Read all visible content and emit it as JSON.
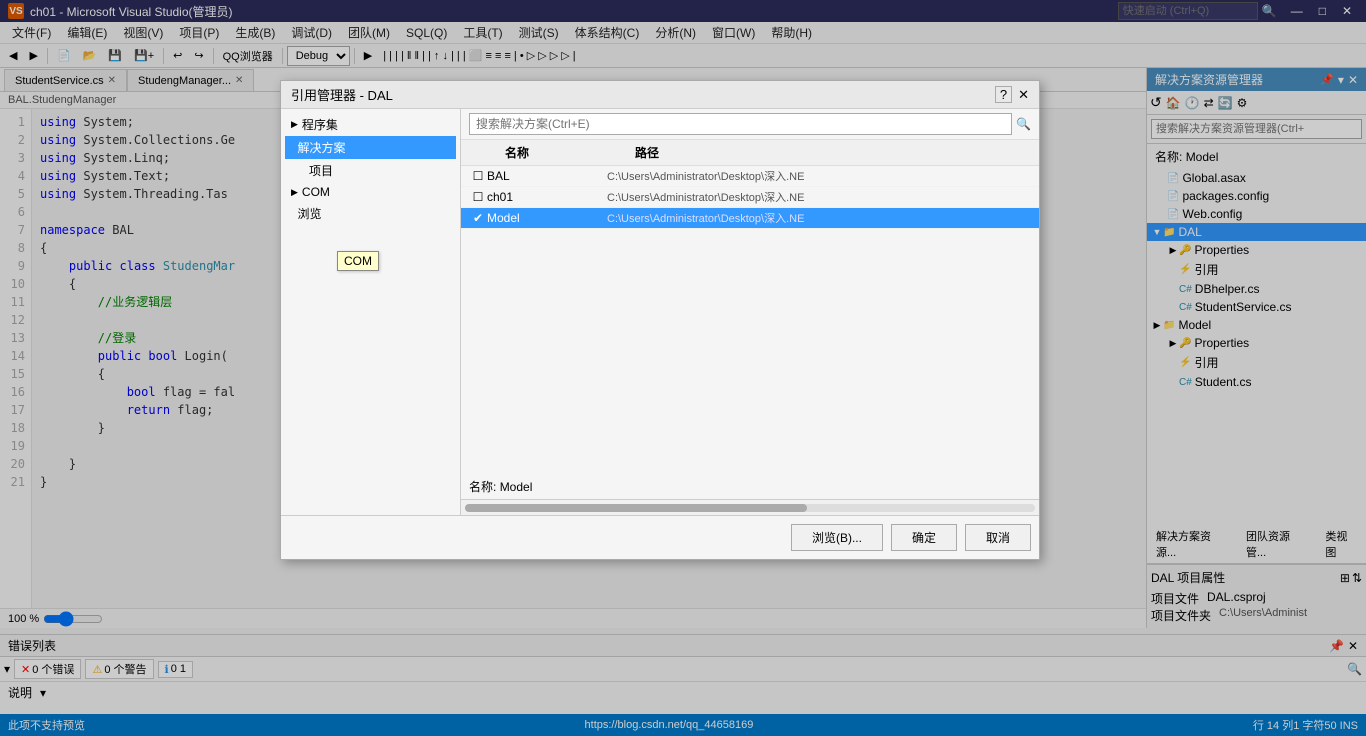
{
  "titleBar": {
    "icon": "VS",
    "title": "ch01 - Microsoft Visual Studio(管理员)",
    "searchPlaceholder": "快速启动 (Ctrl+Q)",
    "controls": [
      "—",
      "□",
      "✕"
    ]
  },
  "menuBar": {
    "items": [
      "文件(F)",
      "编辑(E)",
      "视图(V)",
      "项目(P)",
      "生成(B)",
      "调试(D)",
      "团队(M)",
      "SQL(Q)",
      "工具(T)",
      "测试(S)",
      "体系结构(C)",
      "分析(N)",
      "窗口(W)",
      "帮助(H)"
    ]
  },
  "toolbar": {
    "debugMode": "Debug",
    "browser": "QQ浏览器"
  },
  "tabs": {
    "items": [
      "StudentService.cs",
      "StudengManager...",
      "BAL.StudengManager"
    ]
  },
  "codeEditor": {
    "breadcrumb": "BAL.StudengManager",
    "lines": [
      {
        "num": 1,
        "text": "using System;",
        "indent": 0
      },
      {
        "num": 2,
        "text": "using System.Collections.Ge",
        "indent": 0
      },
      {
        "num": 3,
        "text": "using System.Linq;",
        "indent": 0
      },
      {
        "num": 4,
        "text": "using System.Text;",
        "indent": 0
      },
      {
        "num": 5,
        "text": "using System.Threading.Tas",
        "indent": 0
      },
      {
        "num": 6,
        "text": "",
        "indent": 0
      },
      {
        "num": 7,
        "text": "namespace BAL",
        "indent": 0
      },
      {
        "num": 8,
        "text": "{",
        "indent": 0
      },
      {
        "num": 9,
        "text": "public class StudengMar",
        "indent": 1
      },
      {
        "num": 10,
        "text": "{",
        "indent": 2
      },
      {
        "num": 11,
        "text": "//业务逻辑层",
        "indent": 3
      },
      {
        "num": 12,
        "text": "",
        "indent": 0
      },
      {
        "num": 13,
        "text": "//登录",
        "indent": 3
      },
      {
        "num": 14,
        "text": "public bool Login(",
        "indent": 3
      },
      {
        "num": 15,
        "text": "{",
        "indent": 4
      },
      {
        "num": 16,
        "text": "bool flag = fal",
        "indent": 5
      },
      {
        "num": 17,
        "text": "return flag;",
        "indent": 5
      },
      {
        "num": 18,
        "text": "}",
        "indent": 4
      },
      {
        "num": 19,
        "text": "",
        "indent": 0
      },
      {
        "num": 20,
        "text": "}",
        "indent": 2
      },
      {
        "num": 21,
        "text": "}",
        "indent": 0
      }
    ],
    "zoom": "100 %"
  },
  "rightPanel": {
    "title": "解决方案资源管理器",
    "searchPlaceholder": "搜索解决方案资源管理器(Ctrl+",
    "nameLabel": "名称:",
    "nameValue": "Model",
    "treeItems": [
      {
        "label": "Global.asax",
        "level": 1,
        "icon": "file",
        "hasArrow": false
      },
      {
        "label": "packages.config",
        "level": 1,
        "icon": "file",
        "hasArrow": false
      },
      {
        "label": "Web.config",
        "level": 1,
        "icon": "file",
        "hasArrow": false
      },
      {
        "label": "DAL",
        "level": 0,
        "icon": "folder",
        "hasArrow": true,
        "selected": true
      },
      {
        "label": "Properties",
        "level": 1,
        "icon": "folder",
        "hasArrow": true
      },
      {
        "label": "引用",
        "level": 1,
        "icon": "ref",
        "hasArrow": false
      },
      {
        "label": "DBhelper.cs",
        "level": 1,
        "icon": "cs",
        "hasArrow": false
      },
      {
        "label": "StudentService.cs",
        "level": 1,
        "icon": "cs",
        "hasArrow": false
      },
      {
        "label": "Model",
        "level": 0,
        "icon": "folder",
        "hasArrow": true
      },
      {
        "label": "Properties",
        "level": 1,
        "icon": "folder",
        "hasArrow": true
      },
      {
        "label": "引用",
        "level": 1,
        "icon": "ref",
        "hasArrow": false
      },
      {
        "label": "Student.cs",
        "level": 1,
        "icon": "cs",
        "hasArrow": false
      }
    ],
    "subTabs": [
      "解决方案资源...",
      "团队资源管...",
      "类视图"
    ]
  },
  "bottomPanel": {
    "title": "错误列表",
    "errorCount": "0 个错误",
    "warningCount": "0 个警告",
    "messageCount": "0 1",
    "filterLabel": "说明"
  },
  "statusBar": {
    "leftText": "此项不支持预览",
    "rightText": "行 14    列1    字符50    INS",
    "url": "https://blog.csdn.net/qq_44658169"
  },
  "modal": {
    "title": "引用管理器 - DAL",
    "closeBtn": "✕",
    "questionBtn": "?",
    "leftItems": [
      {
        "label": "程序集",
        "hasArrow": true,
        "level": 0
      },
      {
        "label": "解决方案",
        "hasArrow": false,
        "level": 0,
        "selected": true
      },
      {
        "label": "项目",
        "hasArrow": false,
        "level": 1
      },
      {
        "label": "COM",
        "hasArrow": true,
        "level": 0
      },
      {
        "label": "浏览",
        "hasArrow": false,
        "level": 0
      }
    ],
    "searchPlaceholder": "搜索解决方案(Ctrl+E)",
    "nameLabel": "名称:",
    "nameValue": "Model",
    "columns": [
      "名称",
      "路径"
    ],
    "rows": [
      {
        "checked": false,
        "name": "BAL",
        "path": "C:\\Users\\Administrator\\Desktop\\深入.NE"
      },
      {
        "checked": false,
        "name": "ch01",
        "path": "C:\\Users\\Administrator\\Desktop\\深入.NE"
      },
      {
        "checked": true,
        "name": "Model",
        "path": "C:\\Users\\Administrator\\Desktop\\深入.NE",
        "selected": true
      }
    ],
    "buttons": {
      "browse": "浏览(B)...",
      "ok": "确定",
      "cancel": "取消"
    },
    "tooltip": "COM"
  }
}
